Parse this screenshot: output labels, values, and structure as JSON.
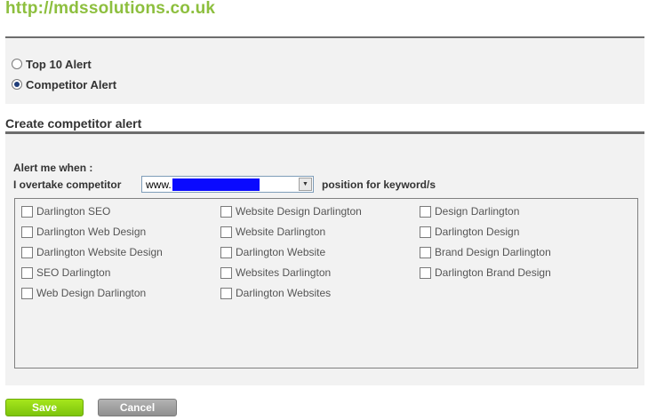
{
  "header": {
    "site_url": "http://mdssolutions.co.uk"
  },
  "alert_type": {
    "options": [
      {
        "label": "Top 10 Alert",
        "selected": false
      },
      {
        "label": "Competitor Alert",
        "selected": true
      }
    ]
  },
  "competitor_alert": {
    "heading": "Create competitor alert",
    "alert_me_label": "Alert me when :",
    "overtake_label": "I overtake competitor",
    "competitor_select": {
      "value": "www.",
      "redacted": true,
      "redaction_color": "#0a0aff"
    },
    "position_label": "position for keyword/s",
    "keywords": [
      [
        "Darlington SEO",
        "Website Design Darlington",
        "Design Darlington"
      ],
      [
        "Darlington Web Design",
        "Website Darlington",
        "Darlington Design"
      ],
      [
        "Darlington Website Design",
        "Darlington Website",
        "Brand Design Darlington"
      ],
      [
        "SEO Darlington",
        "Websites Darlington",
        "Darlington Brand Design"
      ],
      [
        "Web Design Darlington",
        "Darlington Websites",
        ""
      ]
    ]
  },
  "actions": {
    "save_label": "Save",
    "cancel_label": "Cancel"
  },
  "colors": {
    "brand_green": "#8dbf3e",
    "save_button": "#7cc40c",
    "cancel_button": "#8f8f8f",
    "panel_background": "#f2f2f2"
  }
}
